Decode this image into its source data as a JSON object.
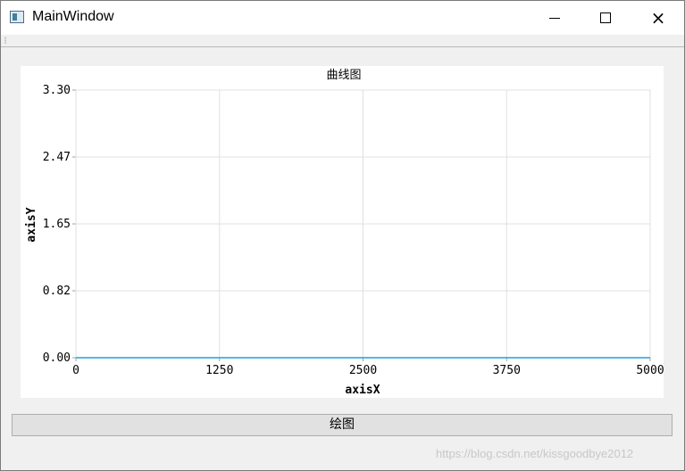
{
  "window": {
    "title": "MainWindow",
    "icon": "qt-window-icon",
    "controls": {
      "minimize": "minimize-icon",
      "maximize": "maximize-icon",
      "close": "×"
    }
  },
  "chart_data": {
    "type": "line",
    "title": "曲线图",
    "xlabel": "axisX",
    "ylabel": "axisY",
    "xlim": [
      0,
      5000
    ],
    "ylim": [
      0,
      3.3
    ],
    "x_ticks": [
      "0",
      "1250",
      "2500",
      "3750",
      "5000"
    ],
    "y_ticks": [
      "3.30",
      "2.47",
      "1.65",
      "0.82",
      "0.00"
    ],
    "grid": true,
    "series": [
      {
        "x": [
          0,
          5000
        ],
        "y": [
          0,
          0
        ],
        "color": "#209fdf"
      }
    ]
  },
  "button": {
    "label": "绘图"
  },
  "watermark": "https://blog.csdn.net/kissgoodbye2012",
  "colors": {
    "series": "#209fdf",
    "grid": "#e0e0e0",
    "axis": "#d0d0d0"
  }
}
